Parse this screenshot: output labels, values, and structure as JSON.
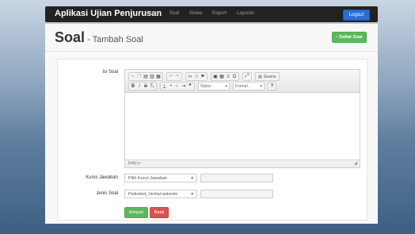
{
  "navbar": {
    "brand": "Aplikasi Ujian Penjurusan",
    "links": [
      "Home",
      "Soal",
      "Siswa",
      "Raport",
      "Laporan"
    ],
    "logout": "Logout"
  },
  "page": {
    "title": "Soal",
    "separator": " - ",
    "subtitle": "Tambah Soal",
    "back_button": "Daftar Soal",
    "back_icon": "‹"
  },
  "form": {
    "isi_soal_label": "Isi Soal",
    "editor": {
      "source_label": "Source",
      "styles_label": "Styles",
      "format_label": "Format",
      "help_label": "?",
      "status_path": "body",
      "status_sep": "p"
    },
    "kunci_label": "Kunci Jawaban",
    "kunci_select": "Pilih Kunci Jawaban",
    "jenis_label": "Jenis Soal",
    "jenis_select": "Psikotest_Verbal-antonim",
    "save_button": "Simpan",
    "cancel_button": "Batal"
  },
  "colors": {
    "save": "#5cb85c",
    "cancel": "#d9534f",
    "logout": "#2a6fd6",
    "navbar": "#222222"
  }
}
